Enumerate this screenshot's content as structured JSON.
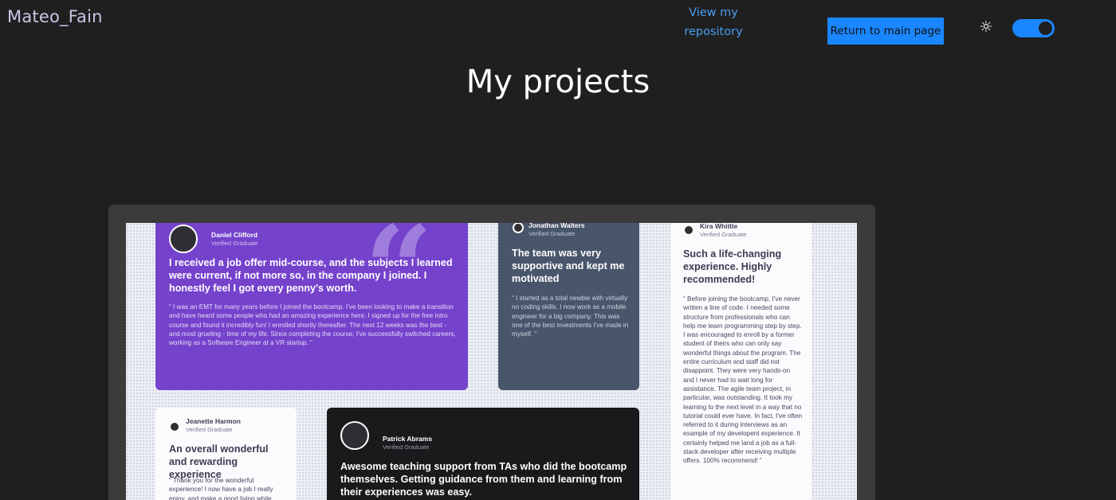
{
  "header": {
    "brand": "Mateo_Fain",
    "repo_link": "View my repository",
    "main_button": "Return to main page",
    "theme_icon": "sun-icon",
    "toggle_state": "on"
  },
  "page": {
    "title": "My projects"
  },
  "preview": {
    "cards": [
      {
        "name": "Daniel Clifford",
        "role": "Verified Graduate",
        "headline": "I received a job offer mid-course, and the subjects I learned were current, if not more so, in the company I joined. I honestly feel I got every penny's worth.",
        "quote": "“ I was an EMT for many years before I joined the bootcamp. I've been looking to make a transition and have heard some people who had an amazing experience here. I signed up for the free intro course and found it incredibly fun! I enrolled shortly thereafter. The next 12 weeks was the best - and most grueling - time of my life. Since completing the course, I've successfully switched careers, working as a Software Engineer at a VR startup. ”"
      },
      {
        "name": "Jonathan Walters",
        "role": "Verified Graduate",
        "headline": "The team was very supportive and kept me motivated",
        "quote": "“ I started as a total newbie with virtually no coding skills. I now work as a mobile engineer for a big company. This was one of the best investments I've made in myself. ”"
      },
      {
        "name": "Kira Whittle",
        "role": "Verified Graduate",
        "headline": "Such a life-changing experience. Highly recommended!",
        "quote": "“ Before joining the bootcamp, I've never written a line of code. I needed some structure from professionals who can help me learn programming step by step. I was encouraged to enroll by a former student of theirs who can only say wonderful things about the program. The entire curriculum and staff did not disappoint. They were very hands-on and I never had to wait long for assistance. The agile team project, in particular, was outstanding. It took my learning to the next level in a way that no tutorial could ever have. In fact, I've often referred to it during interviews as an example of my developent experience. It certainly helped me land a job as a full-stack developer after receiving multiple offers. 100% recommend! ”"
      },
      {
        "name": "Jeanette Harmon",
        "role": "Verified Graduate",
        "headline": "An overall wonderful and rewarding experience",
        "quote": "“ Thank you for the wonderful experience! I now have a job I really enjoy, and make a good living while"
      },
      {
        "name": "Patrick Abrams",
        "role": "Verified Graduate",
        "headline": "Awesome teaching support from TAs who did the bootcamp themselves. Getting guidance from them and learning from their experiences was easy."
      }
    ]
  }
}
